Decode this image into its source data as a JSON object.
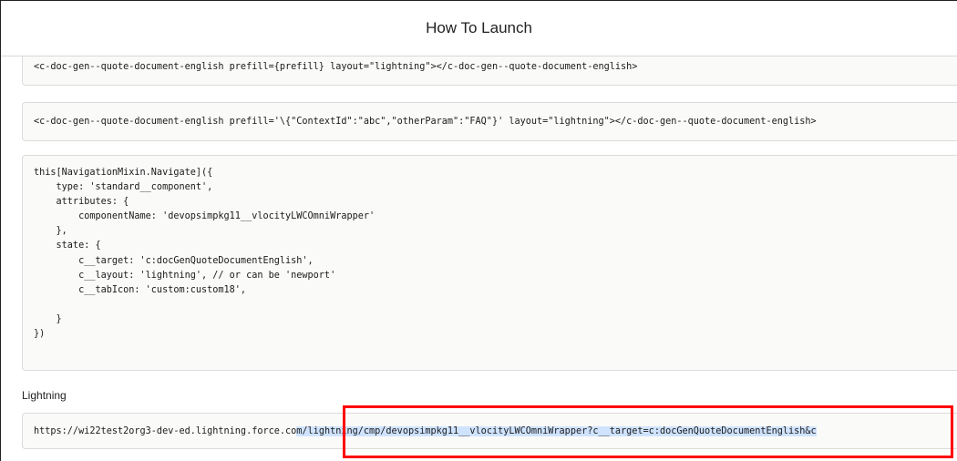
{
  "dialog": {
    "title": "How To Launch"
  },
  "snippets": {
    "lwc_tag": "<c-doc-gen--quote-document-english prefill={prefill} layout=\"lightning\"></c-doc-gen--quote-document-english>",
    "lwc_tag_prefill": "<c-doc-gen--quote-document-english prefill='\\{\"ContextId\":\"abc\",\"otherParam\":\"FAQ\"}' layout=\"lightning\"></c-doc-gen--quote-document-english>",
    "navigation": "this[NavigationMixin.Navigate]({\n    type: 'standard__component',\n    attributes: {\n        componentName: 'devopsimpkg11__vlocityLWCOmniWrapper'\n    },\n    state: {\n        c__target: 'c:docGenQuoteDocumentEnglish',\n        c__layout: 'lightning', // or can be 'newport'\n        c__tabIcon: 'custom:custom18',\n\n    }\n})"
  },
  "lightning": {
    "label": "Lightning",
    "url_host": "https://wi22test2org3-dev-ed.lightning.force.co",
    "url_path": "m/lightning/cmp/devopsimpkg11__vlocityLWCOmniWrapper?c__target=c:docGenQuoteDocumentEnglish&c"
  },
  "colors": {
    "highlight_border": "#ff0000",
    "selection": "#cfe3ff"
  }
}
